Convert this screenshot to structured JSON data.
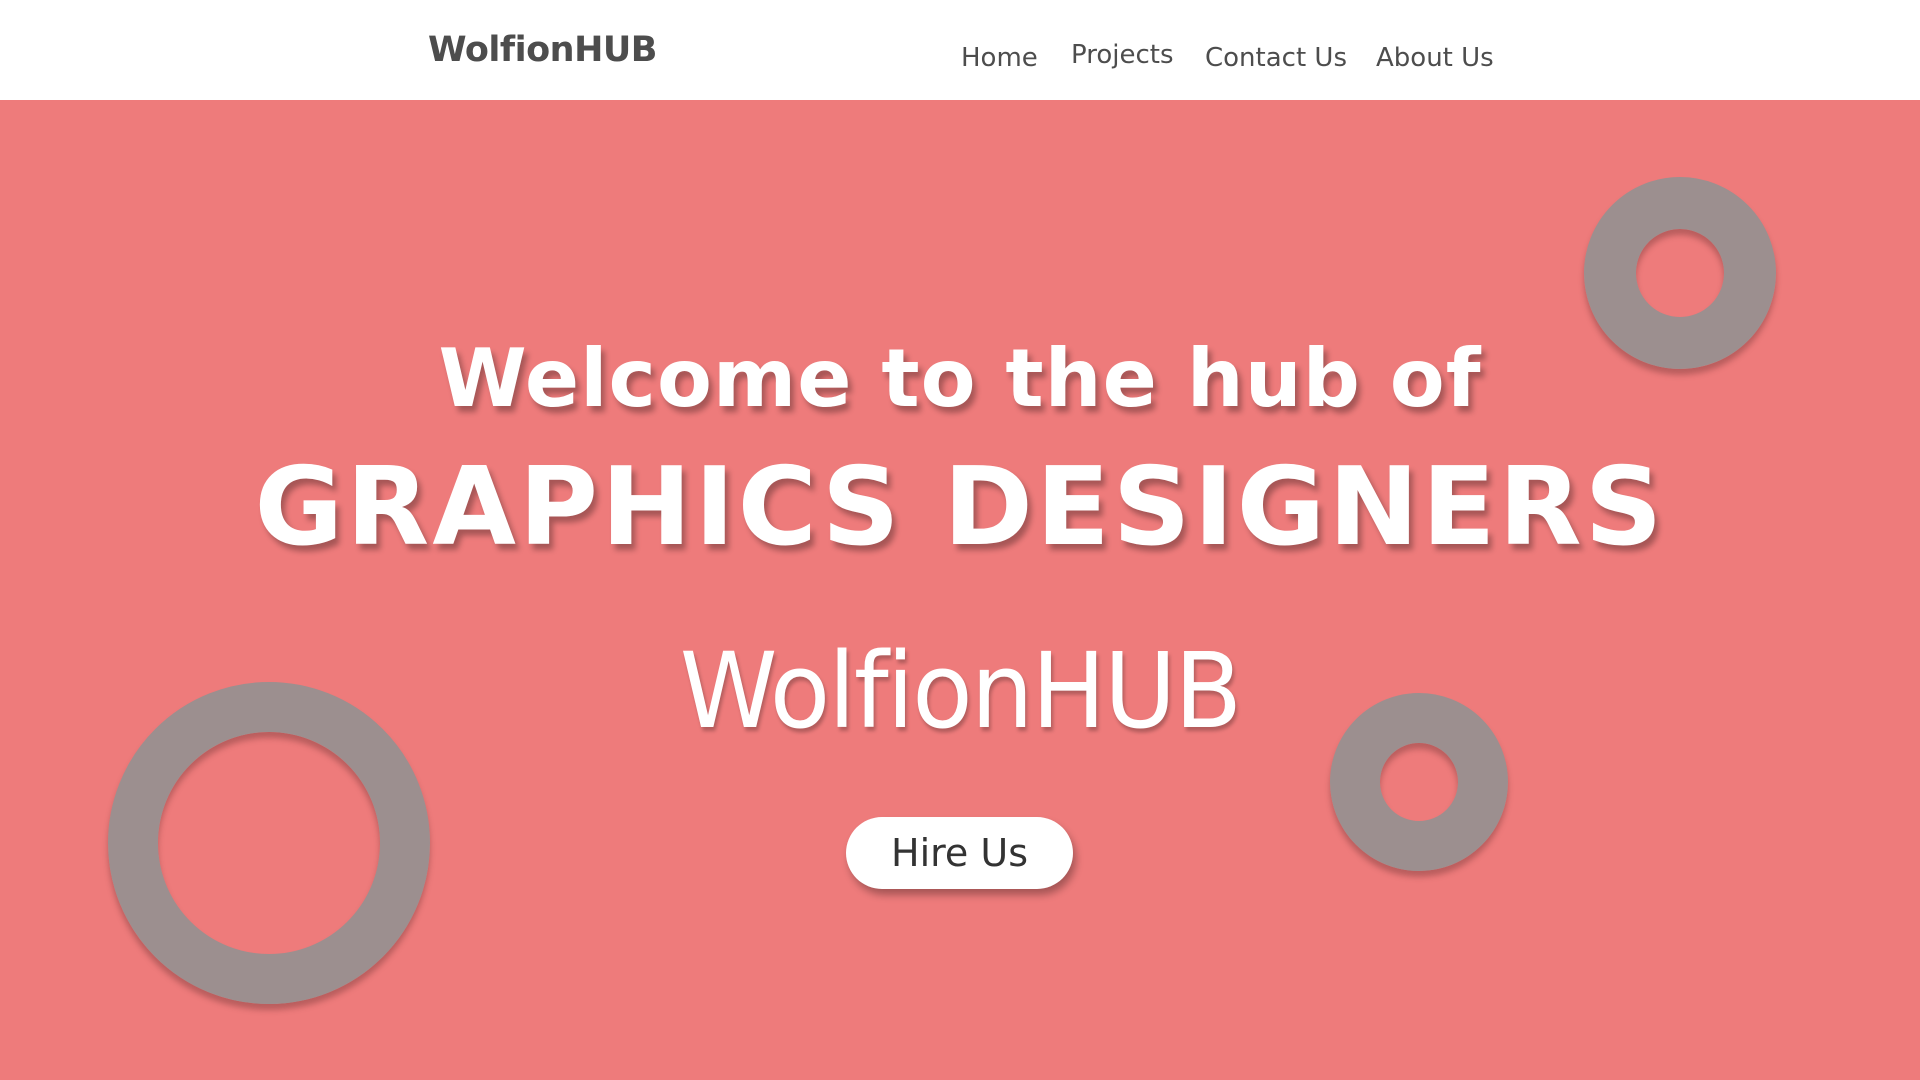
{
  "header": {
    "brand": "WolfionHUB",
    "nav": {
      "home": "Home",
      "projects": "Projects",
      "contact": "Contact Us",
      "about": "About Us"
    }
  },
  "hero": {
    "welcome": "Welcome to the hub of",
    "headline": "GRAPHICS DESIGNERS",
    "wordmark": "WolfionHUB",
    "cta_label": "Hire Us"
  },
  "colors": {
    "hero_background": "#ee7b7b",
    "ring": "#9c8f8f",
    "header_text": "#4d4d4d",
    "hero_text": "#ffffff"
  }
}
